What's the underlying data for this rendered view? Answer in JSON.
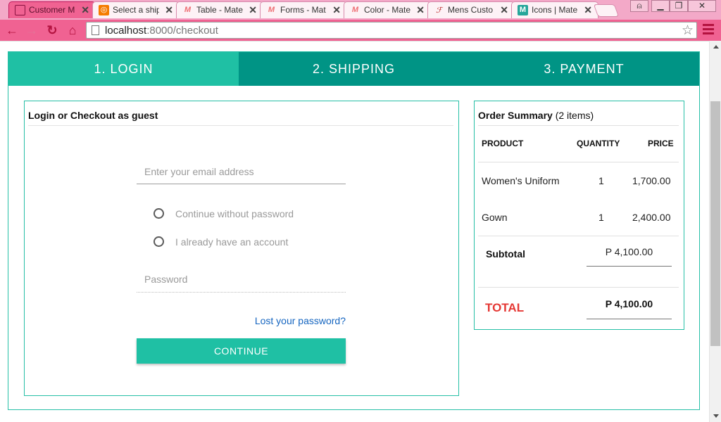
{
  "browser": {
    "tabs": [
      {
        "title": "Customer M",
        "icon": "page-icon",
        "color": "#c2185b"
      },
      {
        "title": "Select a ship",
        "icon": "shipping-logo-icon",
        "color": "#f57c00"
      },
      {
        "title": "Table - Mate",
        "icon": "materialize-icon",
        "color": "#ee6e73"
      },
      {
        "title": "Forms - Mat",
        "icon": "materialize-icon",
        "color": "#ee6e73"
      },
      {
        "title": "Color - Mate",
        "icon": "materialize-icon",
        "color": "#ee6e73"
      },
      {
        "title": "Mens Custo",
        "icon": "script-logo-icon",
        "color": "#b71c1c"
      },
      {
        "title": "Icons | Mate",
        "icon": "materialize-m-icon",
        "color": "#26a69a"
      }
    ],
    "url_host": "localhost",
    "url_path": ":8000/checkout"
  },
  "steps": [
    {
      "label": "1. LOGIN",
      "active": true
    },
    {
      "label": "2. SHIPPING",
      "active": false
    },
    {
      "label": "3. PAYMENT",
      "active": false
    }
  ],
  "login": {
    "title": "Login or Checkout as guest",
    "email_placeholder": "Enter your email address",
    "options": [
      "Continue without password",
      "I already have an account"
    ],
    "password_placeholder": "Password",
    "lost_password": "Lost your password?",
    "continue_label": "CONTINUE"
  },
  "summary": {
    "title": "Order Summary",
    "count": "(2 items)",
    "columns": [
      "PRODUCT",
      "QUANTITY",
      "PRICE"
    ],
    "items": [
      {
        "product": "Women's Uniform",
        "quantity": "1",
        "price": "1,700.00"
      },
      {
        "product": "Gown",
        "quantity": "1",
        "price": "2,400.00"
      }
    ],
    "subtotal_label": "Subtotal",
    "subtotal_value": "P 4,100.00",
    "total_label": "TOTAL",
    "total_value": "P 4,100.00"
  },
  "colors": {
    "accent": "#1fc0a4",
    "accent_dark": "#009485",
    "total": "#e53935",
    "link": "#1565c0"
  }
}
